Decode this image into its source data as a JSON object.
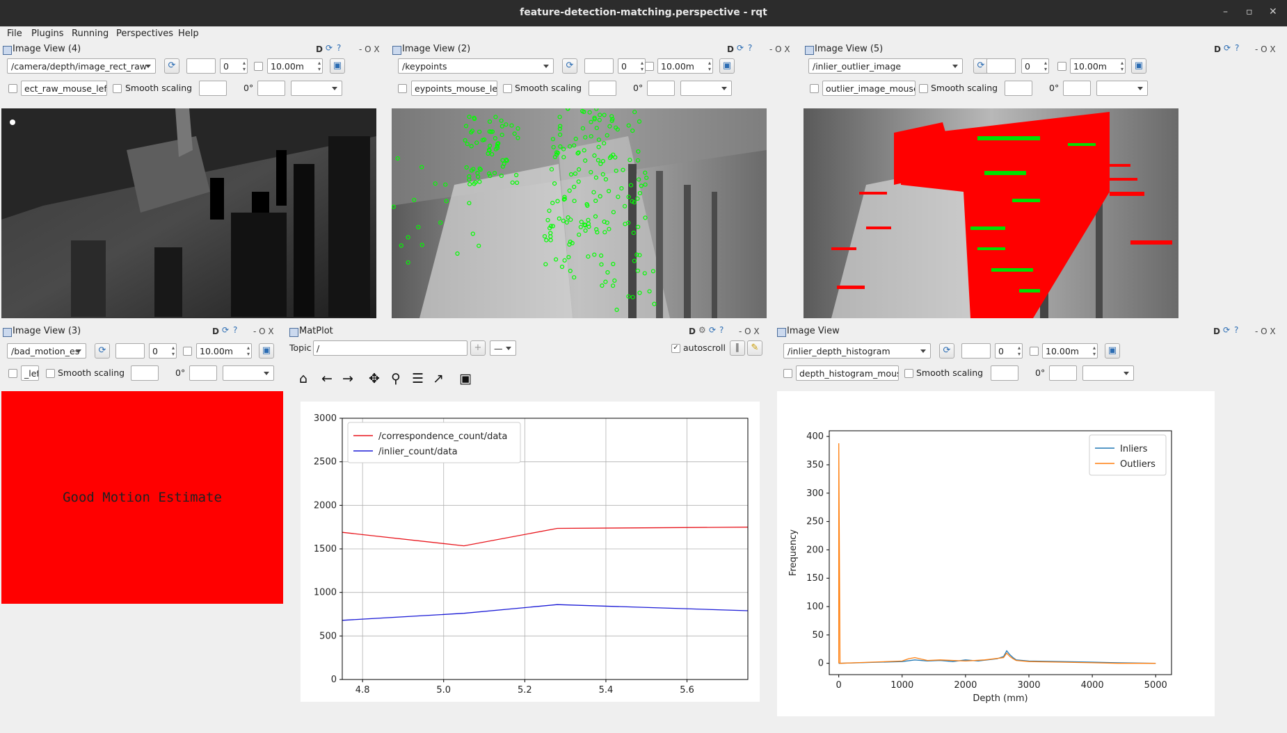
{
  "window": {
    "title": "feature-detection-matching.perspective - rqt",
    "controls": [
      "–",
      "▫",
      "✕"
    ]
  },
  "menu": [
    "File",
    "Plugins",
    "Running",
    "Perspectives",
    "Help"
  ],
  "common": {
    "dock_buttons": [
      "D",
      "- O X"
    ],
    "smooth_label": "Smooth scaling",
    "rotation": "0°",
    "spin_value": "0",
    "max_value": "10.00m"
  },
  "panels": {
    "iv4": {
      "title": "Image View (4)",
      "topic": "/camera/depth/image_rect_raw",
      "mouse": "ect_raw_mouse_left"
    },
    "iv2": {
      "title": "Image View (2)",
      "topic": "/keypoints",
      "mouse": "eypoints_mouse_left"
    },
    "iv5": {
      "title": "Image View (5)",
      "topic": "/inlier_outlier_image",
      "mouse": "outlier_image_mouse_left"
    },
    "iv3": {
      "title": "Image View (3)",
      "topic": "/bad_motion_es",
      "mouse": "_left",
      "image_text": "Good Motion Estimate"
    },
    "iv0": {
      "title": "Image View",
      "topic": "/inlier_depth_histogram",
      "mouse": "depth_histogram_mouse_left"
    },
    "matplot": {
      "title": "MatPlot",
      "topic_label": "Topic",
      "topic_value": "/",
      "autoscroll": "autoscroll"
    }
  },
  "colors": {
    "accent_red": "#ff0000",
    "series_red": "#e8141b",
    "series_blue": "#1a1ad6",
    "hist_blue": "#1f77b4",
    "hist_orange": "#ff7f0e"
  },
  "chart_data": [
    {
      "type": "line",
      "title": "",
      "xlabel": "",
      "ylabel": "",
      "xlim": [
        4.75,
        5.75
      ],
      "ylim": [
        0,
        3000
      ],
      "xticks": [
        "4.8",
        "5.0",
        "5.2",
        "5.4",
        "5.6"
      ],
      "yticks": [
        "0",
        "500",
        "1000",
        "1500",
        "2000",
        "2500",
        "3000"
      ],
      "grid": true,
      "legend_position": "top-left",
      "series": [
        {
          "name": "/correspondence_count/data",
          "color": "#e8141b",
          "x": [
            4.75,
            5.05,
            5.28,
            5.75
          ],
          "y": [
            1690,
            1535,
            1735,
            1750
          ]
        },
        {
          "name": "/inlier_count/data",
          "color": "#1a1ad6",
          "x": [
            4.75,
            5.05,
            5.28,
            5.75
          ],
          "y": [
            680,
            760,
            860,
            790
          ]
        }
      ]
    },
    {
      "type": "line",
      "title": "",
      "xlabel": "Depth (mm)",
      "ylabel": "Frequency",
      "xlim": [
        -150,
        5250
      ],
      "ylim": [
        -20,
        410
      ],
      "xticks": [
        "0",
        "1000",
        "2000",
        "3000",
        "4000",
        "5000"
      ],
      "yticks": [
        "0",
        "50",
        "100",
        "150",
        "200",
        "250",
        "300",
        "350",
        "400"
      ],
      "grid": false,
      "legend_position": "top-right",
      "series": [
        {
          "name": "Inliers",
          "color": "#1f77b4",
          "x": [
            0,
            1000,
            1200,
            1400,
            1600,
            1800,
            2000,
            2200,
            2500,
            2600,
            2650,
            2700,
            2750,
            2800,
            3000,
            3500,
            4000,
            4400,
            5000
          ],
          "y": [
            0,
            3,
            6,
            4,
            5,
            3,
            6,
            4,
            8,
            12,
            22,
            15,
            10,
            6,
            4,
            3,
            2,
            1,
            0
          ]
        },
        {
          "name": "Outliers",
          "color": "#ff7f0e",
          "x": [
            0,
            0,
            20,
            1000,
            1100,
            1200,
            1400,
            1600,
            2000,
            2300,
            2600,
            2650,
            2700,
            2750,
            2800,
            3000,
            3500,
            4000,
            4400,
            5000
          ],
          "y": [
            0,
            388,
            0,
            4,
            8,
            10,
            5,
            6,
            4,
            6,
            10,
            18,
            12,
            8,
            5,
            3,
            2,
            1,
            0,
            0
          ]
        }
      ]
    }
  ]
}
